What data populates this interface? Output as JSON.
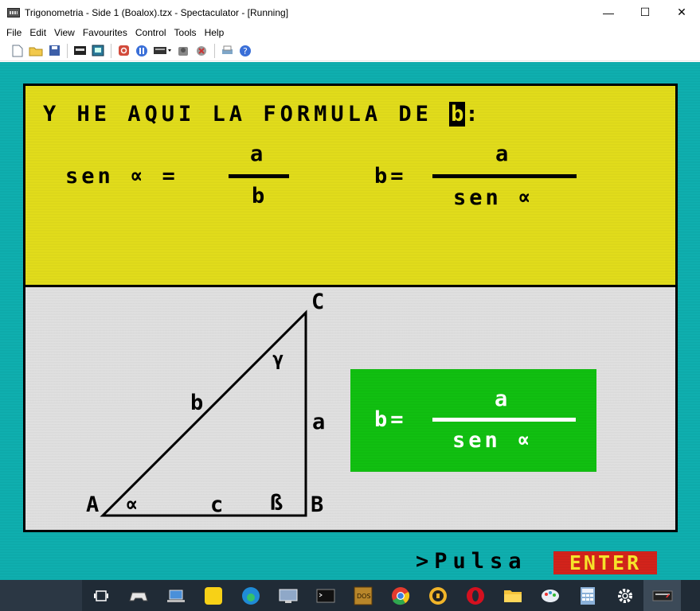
{
  "window": {
    "title": "Trigonometria - Side 1 (Boalox).tzx - Spectaculator - [Running]",
    "minimize_glyph": "—",
    "maximize_glyph": "☐",
    "close_glyph": "✕"
  },
  "menu": [
    "File",
    "Edit",
    "View",
    "Favourites",
    "Control",
    "Tools",
    "Help"
  ],
  "toolbar_icons": [
    "new-file-icon",
    "open-folder-icon",
    "save-icon",
    "tape-icon",
    "snapshot-icon",
    "reset-icon",
    "pause-icon",
    "keyboard-icon",
    "joystick-icon",
    "audio-icon",
    "printer-icon",
    "help-icon"
  ],
  "screen": {
    "heading_prefix": "Y HE AQUI LA FORMULA DE ",
    "heading_highlight": "b",
    "heading_suffix": ":",
    "formula1": {
      "lhs": "sen ∝ =",
      "numerator": "a",
      "denominator": "b"
    },
    "formula2": {
      "lhs": "b=",
      "numerator": "a",
      "denominator": "sen ∝"
    },
    "triangle": {
      "vertex_a": "A",
      "vertex_b": "B",
      "vertex_c": "C",
      "side_a": "a",
      "side_b": "b",
      "side_c": "c",
      "angle_alpha": "∝",
      "angle_beta": "ß",
      "angle_gamma": "γ"
    },
    "result": {
      "lhs": "b=",
      "numerator": "a",
      "denominator": "sen ∝"
    },
    "prompt": ">Pulsa",
    "enter_key": "ENTER"
  },
  "colors": {
    "border_cyan": "#0fb3b3",
    "panel_yellow": "#e5e01c",
    "panel_white": "#e3e3e3",
    "result_green": "#11c311",
    "enter_red": "#d8241c",
    "enter_text": "#f5e32a"
  },
  "taskbar_icons": [
    "task-view-icon",
    "game-controller-icon",
    "laptop-icon",
    "sticky-notes-icon",
    "edge-icon",
    "remote-desktop-icon",
    "terminal-icon",
    "dosbox-icon",
    "chrome-icon",
    "vpn-icon",
    "opera-icon",
    "file-explorer-icon",
    "paint-icon",
    "calculator-icon",
    "settings-icon",
    "spectaculator-icon"
  ]
}
